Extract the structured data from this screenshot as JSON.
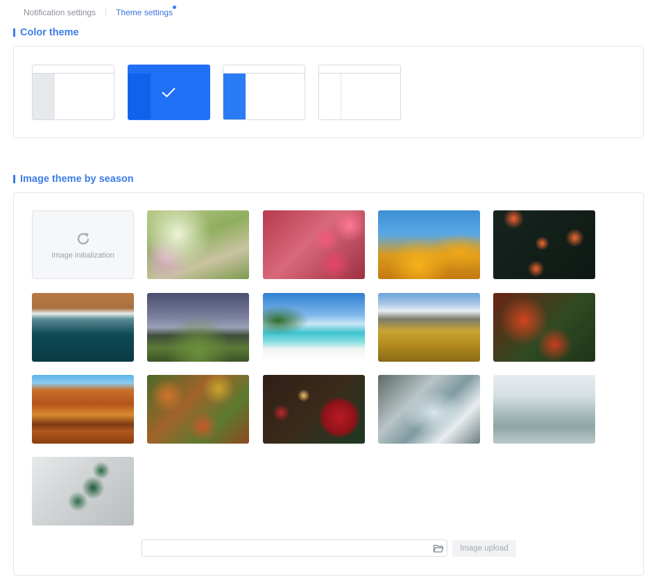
{
  "tabs": [
    {
      "label": "Notification settings",
      "active": false
    },
    {
      "label": "Theme settings",
      "active": true
    }
  ],
  "color_theme": {
    "title": "Color theme",
    "selected_index": 1,
    "options": [
      {
        "name": "gray-sidebar",
        "sidebar_color": "#e6e8ec"
      },
      {
        "name": "blue-full",
        "sidebar_color": "#0f62ea",
        "fill_color": "#1f70f5"
      },
      {
        "name": "blue-sidebar",
        "sidebar_color": "#2a7bf4"
      },
      {
        "name": "white",
        "sidebar_color": "#ffffff"
      }
    ]
  },
  "image_theme": {
    "title": "Image theme by season",
    "init_label": "Image initialization",
    "images": [
      {
        "name": "spring-garden-path"
      },
      {
        "name": "pink-flowers"
      },
      {
        "name": "yellow-poppies"
      },
      {
        "name": "orange-lantana"
      },
      {
        "name": "aerial-beach-waves"
      },
      {
        "name": "rocky-coast"
      },
      {
        "name": "tropical-beach"
      },
      {
        "name": "autumn-mountains"
      },
      {
        "name": "red-autumn-leaves"
      },
      {
        "name": "autumn-forest-lake"
      },
      {
        "name": "aerial-autumn-forest"
      },
      {
        "name": "christmas-ornaments"
      },
      {
        "name": "snowy-forest-road"
      },
      {
        "name": "frosty-forest"
      },
      {
        "name": "frosted-leaves"
      }
    ],
    "upload": {
      "value": "",
      "button_label": "Image upload"
    }
  },
  "colors": {
    "accent": "#3d7de6",
    "selected_theme": "#1f70f5"
  }
}
